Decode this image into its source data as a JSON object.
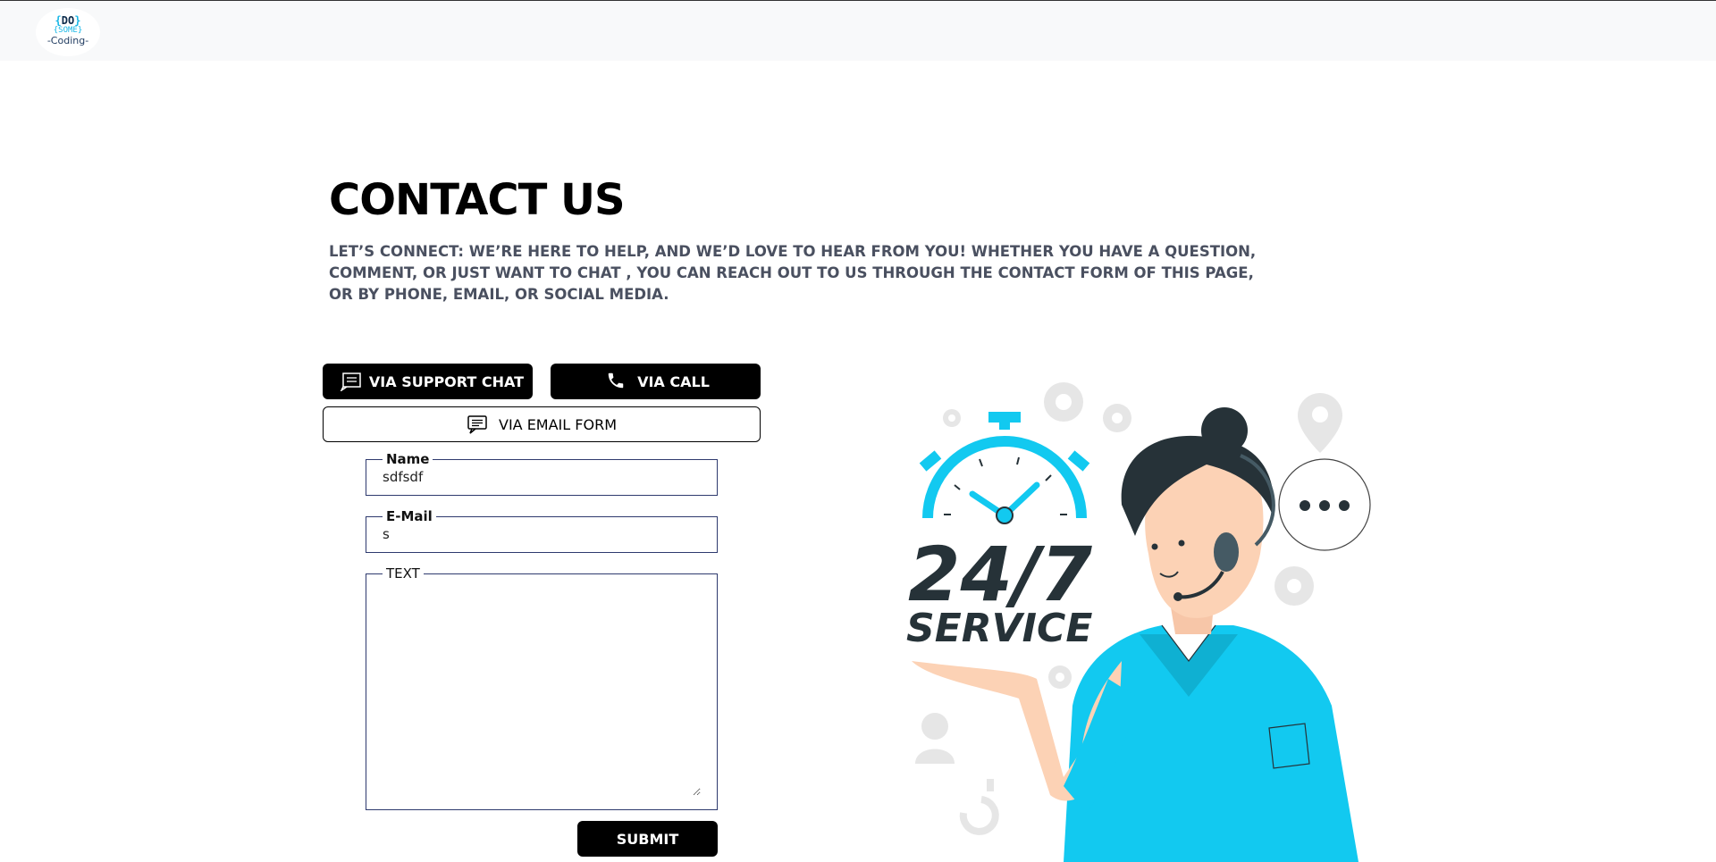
{
  "header": {
    "logo": {
      "line1_left": "{",
      "line1_mid": "DO",
      "line1_right": "}",
      "line2": "{SOME}",
      "line3": "-Coding-"
    }
  },
  "main": {
    "title": "CONTACT US",
    "intro": "LET’S CONNECT: WE’RE HERE TO HELP, AND WE’D LOVE TO HEAR FROM YOU! WHETHER YOU HAVE A QUESTION, COMMENT, OR JUST WANT TO CHAT , YOU CAN REACH OUT TO US THROUGH THE CONTACT FORM OF THIS PAGE, OR BY PHONE, EMAIL, OR SOCIAL MEDIA."
  },
  "contact_options": {
    "chat_label": "VIA SUPPORT CHAT",
    "call_label": "VIA CALL",
    "email_label": "VIA EMAIL FORM"
  },
  "form": {
    "name_label": "Name",
    "name_value": "sdfsdf",
    "email_label": "E-Mail",
    "email_value": "s",
    "text_label": "TEXT",
    "text_value": "",
    "submit_label": "SUBMIT"
  },
  "illustration": {
    "headline": "24/7",
    "subline": "SERVICE",
    "accent_color": "#12c9f0",
    "dark_color": "#263238"
  },
  "icons": [
    "chat-icon",
    "phone-icon",
    "email-form-icon",
    "gear-icon",
    "location-pin-icon",
    "speech-bubble-icon",
    "user-icon",
    "question-mark-icon",
    "stopwatch-icon"
  ]
}
